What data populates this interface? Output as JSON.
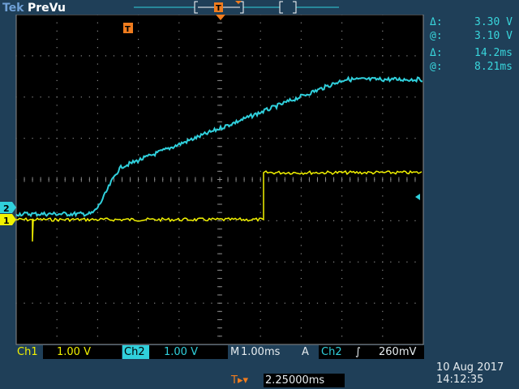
{
  "header": {
    "brand": "Tek",
    "mode": "PreVu",
    "trigger_marker_label": "T"
  },
  "cursor_readout": {
    "voltage_delta_symbol": "Δ:",
    "voltage_delta": "3.30 V",
    "voltage_at_symbol": "@:",
    "voltage_at": "3.10 V",
    "time_delta_symbol": "Δ:",
    "time_delta": "14.2ms",
    "time_at_symbol": "@:",
    "time_at": "8.21ms"
  },
  "channels": {
    "ch1": {
      "label": "Ch1",
      "scale": "1.00 V",
      "marker": "1",
      "color": "#f2f200"
    },
    "ch2": {
      "label": "Ch2",
      "scale": "1.00 V",
      "marker": "2",
      "color": "#30d0dc"
    }
  },
  "timebase": {
    "label": "M",
    "value": "1.00ms"
  },
  "trigger": {
    "mode": "A",
    "source": "Ch2",
    "slope_symbol": "∫",
    "level": "260mV",
    "position_prefix": "T▸▾",
    "position": "2.25000ms"
  },
  "datetime": {
    "date": "10 Aug 2017",
    "time": "14:12:35"
  },
  "colors": {
    "background": "#000000",
    "panel": "#1f3f58",
    "grid": "#8a8a8a",
    "ch1": "#f2f200",
    "ch2": "#30d0dc",
    "trigger": "#f07c1e"
  }
}
